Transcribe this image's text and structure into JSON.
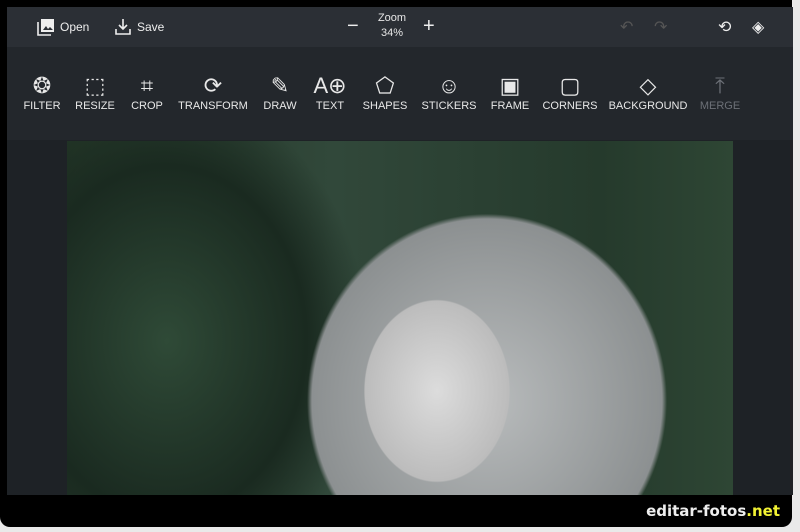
{
  "topbar": {
    "open": "Open",
    "save": "Save",
    "zoom_label": "Zoom",
    "zoom_value": "34%"
  },
  "tools": [
    {
      "label": "FILTER",
      "icon": "aperture-icon"
    },
    {
      "label": "RESIZE",
      "icon": "resize-icon"
    },
    {
      "label": "CROP",
      "icon": "crop-icon"
    },
    {
      "label": "TRANSFORM",
      "icon": "rotate-icon"
    },
    {
      "label": "DRAW",
      "icon": "pencil-icon"
    },
    {
      "label": "TEXT",
      "icon": "text-add-icon"
    },
    {
      "label": "SHAPES",
      "icon": "pentagon-icon"
    },
    {
      "label": "STICKERS",
      "icon": "smiley-icon"
    },
    {
      "label": "FRAME",
      "icon": "frame-icon"
    },
    {
      "label": "CORNERS",
      "icon": "rounded-square-icon"
    },
    {
      "label": "BACKGROUND",
      "icon": "paint-bucket-icon"
    },
    {
      "label": "MERGE",
      "icon": "merge-icon",
      "disabled": true
    }
  ],
  "watermark": {
    "name": "editar-fotos",
    "tld": ".net",
    "tld_color": "#f2f233"
  }
}
